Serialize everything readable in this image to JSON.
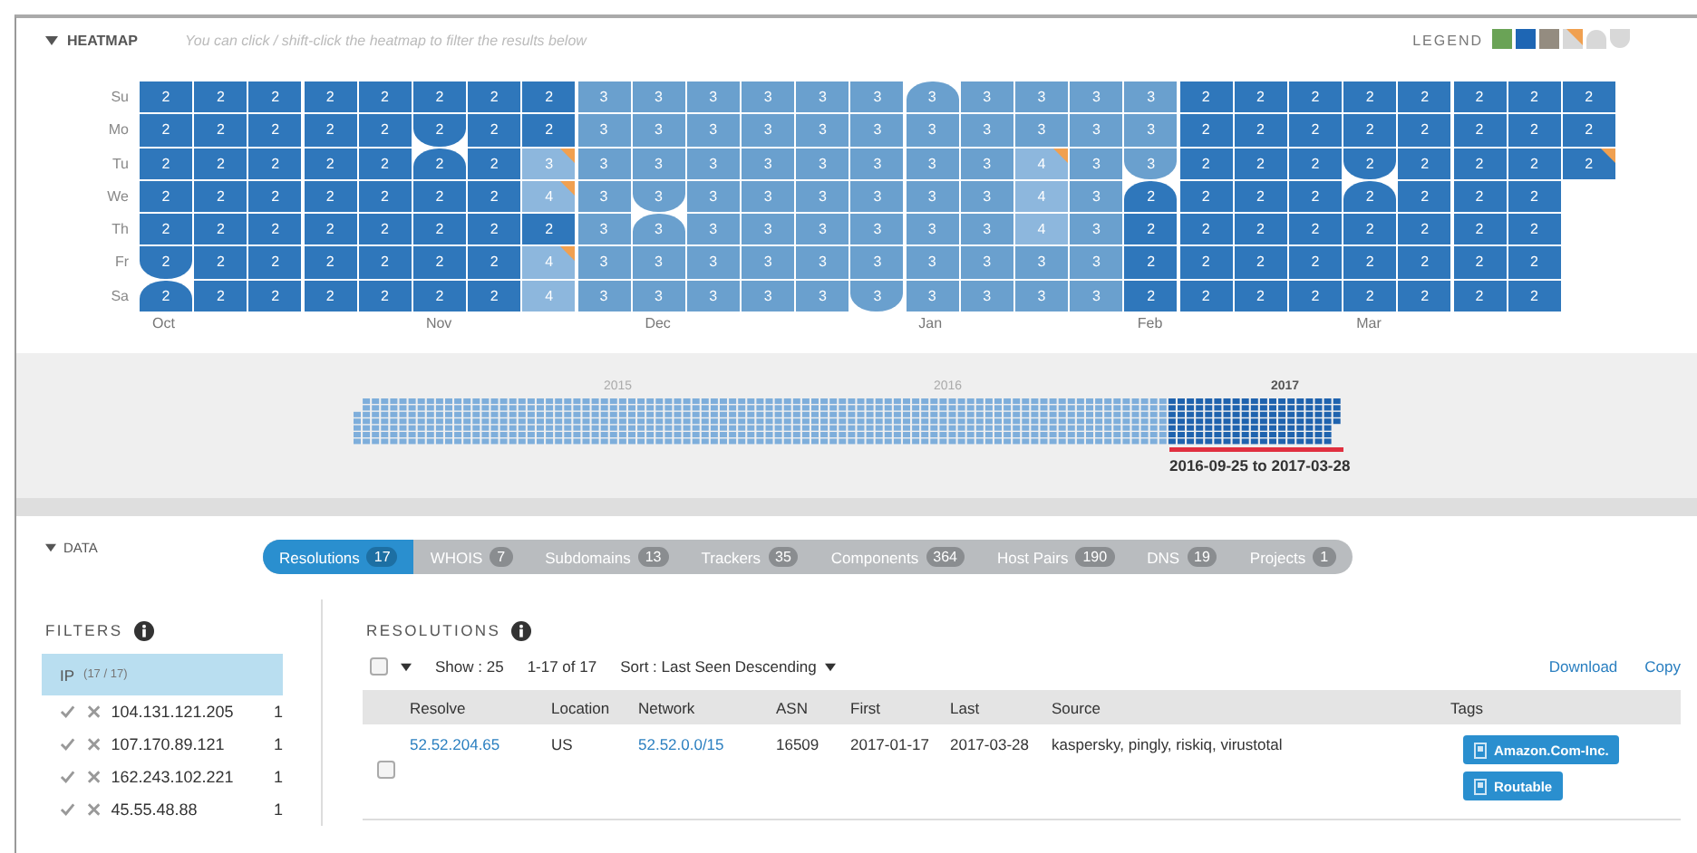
{
  "heatmap": {
    "title": "HEATMAP",
    "hint": "You can click / shift-click the heatmap to filter the results below",
    "legend_label": "LEGEND",
    "days": [
      "Su",
      "Mo",
      "Tu",
      "We",
      "Th",
      "Fr",
      "Sa"
    ],
    "weeks": [
      {
        "month_label": "Oct",
        "cells": [
          {
            "value": "2",
            "color": "#2f77bb",
            "flagged": false,
            "month_start": false
          },
          {
            "value": "2",
            "color": "#2f77bb",
            "flagged": false,
            "month_start": false
          },
          {
            "value": "2",
            "color": "#2f77bb",
            "flagged": false,
            "month_start": false
          },
          {
            "value": "2",
            "color": "#2f77bb",
            "flagged": false,
            "month_start": false
          },
          {
            "value": "2",
            "color": "#2f77bb",
            "flagged": false,
            "month_start": false
          },
          {
            "value": "2",
            "color": "#2f77bb",
            "flagged": false,
            "month_start": false
          },
          {
            "value": "2",
            "color": "#2f77bb",
            "flagged": false,
            "month_start": true
          }
        ]
      },
      {
        "cells": [
          {
            "value": "2",
            "color": "#2f77bb",
            "flagged": false,
            "month_start": false
          },
          {
            "value": "2",
            "color": "#2f77bb",
            "flagged": false,
            "month_start": false
          },
          {
            "value": "2",
            "color": "#2f77bb",
            "flagged": false,
            "month_start": false
          },
          {
            "value": "2",
            "color": "#2f77bb",
            "flagged": false,
            "month_start": false
          },
          {
            "value": "2",
            "color": "#2f77bb",
            "flagged": false,
            "month_start": false
          },
          {
            "value": "2",
            "color": "#2f77bb",
            "flagged": false,
            "month_start": false
          },
          {
            "value": "2",
            "color": "#2f77bb",
            "flagged": false,
            "month_start": false
          }
        ]
      },
      {
        "cells": [
          {
            "value": "2",
            "color": "#2f77bb",
            "flagged": false,
            "month_start": false
          },
          {
            "value": "2",
            "color": "#2f77bb",
            "flagged": false,
            "month_start": false
          },
          {
            "value": "2",
            "color": "#2f77bb",
            "flagged": false,
            "month_start": false
          },
          {
            "value": "2",
            "color": "#2f77bb",
            "flagged": false,
            "month_start": false
          },
          {
            "value": "2",
            "color": "#2f77bb",
            "flagged": false,
            "month_start": false
          },
          {
            "value": "2",
            "color": "#2f77bb",
            "flagged": false,
            "month_start": false
          },
          {
            "value": "2",
            "color": "#2f77bb",
            "flagged": false,
            "month_start": false
          }
        ]
      },
      {
        "cells": [
          {
            "value": "2",
            "color": "#2f77bb",
            "flagged": false,
            "month_start": false
          },
          {
            "value": "2",
            "color": "#2f77bb",
            "flagged": false,
            "month_start": false
          },
          {
            "value": "2",
            "color": "#2f77bb",
            "flagged": false,
            "month_start": false
          },
          {
            "value": "2",
            "color": "#2f77bb",
            "flagged": false,
            "month_start": false
          },
          {
            "value": "2",
            "color": "#2f77bb",
            "flagged": false,
            "month_start": false
          },
          {
            "value": "2",
            "color": "#2f77bb",
            "flagged": false,
            "month_start": false
          },
          {
            "value": "2",
            "color": "#2f77bb",
            "flagged": false,
            "month_start": false
          }
        ]
      },
      {
        "cells": [
          {
            "value": "2",
            "color": "#2f77bb",
            "flagged": false,
            "month_start": false
          },
          {
            "value": "2",
            "color": "#2f77bb",
            "flagged": false,
            "month_start": false
          },
          {
            "value": "2",
            "color": "#2f77bb",
            "flagged": false,
            "month_start": false
          },
          {
            "value": "2",
            "color": "#2f77bb",
            "flagged": false,
            "month_start": false
          },
          {
            "value": "2",
            "color": "#2f77bb",
            "flagged": false,
            "month_start": false
          },
          {
            "value": "2",
            "color": "#2f77bb",
            "flagged": false,
            "month_start": false
          },
          {
            "value": "2",
            "color": "#2f77bb",
            "flagged": false,
            "month_start": false
          }
        ]
      },
      {
        "month_label": "Nov",
        "cells": [
          {
            "value": "2",
            "color": "#2f77bb",
            "flagged": false,
            "month_start": false
          },
          {
            "value": "2",
            "color": "#2f77bb",
            "flagged": false,
            "month_start": false
          },
          {
            "value": "2",
            "color": "#2f77bb",
            "flagged": false,
            "month_start": true
          },
          {
            "value": "2",
            "color": "#2f77bb",
            "flagged": false,
            "month_start": false
          },
          {
            "value": "2",
            "color": "#2f77bb",
            "flagged": false,
            "month_start": false
          },
          {
            "value": "2",
            "color": "#2f77bb",
            "flagged": false,
            "month_start": false
          },
          {
            "value": "2",
            "color": "#2f77bb",
            "flagged": false,
            "month_start": false
          }
        ]
      },
      {
        "cells": [
          {
            "value": "2",
            "color": "#2f77bb",
            "flagged": false,
            "month_start": false
          },
          {
            "value": "2",
            "color": "#2f77bb",
            "flagged": false,
            "month_start": false
          },
          {
            "value": "2",
            "color": "#2f77bb",
            "flagged": false,
            "month_start": false
          },
          {
            "value": "2",
            "color": "#2f77bb",
            "flagged": false,
            "month_start": false
          },
          {
            "value": "2",
            "color": "#2f77bb",
            "flagged": false,
            "month_start": false
          },
          {
            "value": "2",
            "color": "#2f77bb",
            "flagged": false,
            "month_start": false
          },
          {
            "value": "2",
            "color": "#2f77bb",
            "flagged": false,
            "month_start": false
          }
        ]
      },
      {
        "cells": [
          {
            "value": "2",
            "color": "#2f77bb",
            "flagged": false,
            "month_start": false
          },
          {
            "value": "2",
            "color": "#2f77bb",
            "flagged": false,
            "month_start": false
          },
          {
            "value": "3",
            "color": "#8db7dd",
            "flagged": true,
            "month_start": false
          },
          {
            "value": "4",
            "color": "#8db7dd",
            "flagged": true,
            "month_start": false
          },
          {
            "value": "2",
            "color": "#2f77bb",
            "flagged": false,
            "month_start": false
          },
          {
            "value": "4",
            "color": "#8db7dd",
            "flagged": true,
            "month_start": false
          },
          {
            "value": "4",
            "color": "#8db7dd",
            "flagged": false,
            "month_start": false
          }
        ]
      },
      {
        "cells": [
          {
            "value": "3",
            "color": "#6aa0ce",
            "flagged": false,
            "month_start": false
          },
          {
            "value": "3",
            "color": "#6aa0ce",
            "flagged": false,
            "month_start": false
          },
          {
            "value": "3",
            "color": "#6aa0ce",
            "flagged": false,
            "month_start": false
          },
          {
            "value": "3",
            "color": "#6aa0ce",
            "flagged": false,
            "month_start": false
          },
          {
            "value": "3",
            "color": "#6aa0ce",
            "flagged": false,
            "month_start": false
          },
          {
            "value": "3",
            "color": "#6aa0ce",
            "flagged": false,
            "month_start": false
          },
          {
            "value": "3",
            "color": "#6aa0ce",
            "flagged": false,
            "month_start": false
          }
        ]
      },
      {
        "month_label": "Dec",
        "cells": [
          {
            "value": "3",
            "color": "#6aa0ce",
            "flagged": false,
            "month_start": false
          },
          {
            "value": "3",
            "color": "#6aa0ce",
            "flagged": false,
            "month_start": false
          },
          {
            "value": "3",
            "color": "#6aa0ce",
            "flagged": false,
            "month_start": false
          },
          {
            "value": "3",
            "color": "#6aa0ce",
            "flagged": false,
            "month_start": false
          },
          {
            "value": "3",
            "color": "#6aa0ce",
            "flagged": false,
            "month_start": true
          },
          {
            "value": "3",
            "color": "#6aa0ce",
            "flagged": false,
            "month_start": false
          },
          {
            "value": "3",
            "color": "#6aa0ce",
            "flagged": false,
            "month_start": false
          }
        ]
      },
      {
        "cells": [
          {
            "value": "3",
            "color": "#6aa0ce",
            "flagged": false,
            "month_start": false
          },
          {
            "value": "3",
            "color": "#6aa0ce",
            "flagged": false,
            "month_start": false
          },
          {
            "value": "3",
            "color": "#6aa0ce",
            "flagged": false,
            "month_start": false
          },
          {
            "value": "3",
            "color": "#6aa0ce",
            "flagged": false,
            "month_start": false
          },
          {
            "value": "3",
            "color": "#6aa0ce",
            "flagged": false,
            "month_start": false
          },
          {
            "value": "3",
            "color": "#6aa0ce",
            "flagged": false,
            "month_start": false
          },
          {
            "value": "3",
            "color": "#6aa0ce",
            "flagged": false,
            "month_start": false
          }
        ]
      },
      {
        "cells": [
          {
            "value": "3",
            "color": "#6aa0ce",
            "flagged": false,
            "month_start": false
          },
          {
            "value": "3",
            "color": "#6aa0ce",
            "flagged": false,
            "month_start": false
          },
          {
            "value": "3",
            "color": "#6aa0ce",
            "flagged": false,
            "month_start": false
          },
          {
            "value": "3",
            "color": "#6aa0ce",
            "flagged": false,
            "month_start": false
          },
          {
            "value": "3",
            "color": "#6aa0ce",
            "flagged": false,
            "month_start": false
          },
          {
            "value": "3",
            "color": "#6aa0ce",
            "flagged": false,
            "month_start": false
          },
          {
            "value": "3",
            "color": "#6aa0ce",
            "flagged": false,
            "month_start": false
          }
        ]
      },
      {
        "cells": [
          {
            "value": "3",
            "color": "#6aa0ce",
            "flagged": false,
            "month_start": false
          },
          {
            "value": "3",
            "color": "#6aa0ce",
            "flagged": false,
            "month_start": false
          },
          {
            "value": "3",
            "color": "#6aa0ce",
            "flagged": false,
            "month_start": false
          },
          {
            "value": "3",
            "color": "#6aa0ce",
            "flagged": false,
            "month_start": false
          },
          {
            "value": "3",
            "color": "#6aa0ce",
            "flagged": false,
            "month_start": false
          },
          {
            "value": "3",
            "color": "#6aa0ce",
            "flagged": false,
            "month_start": false
          },
          {
            "value": "3",
            "color": "#6aa0ce",
            "flagged": false,
            "month_start": false
          }
        ]
      },
      {
        "cells": [
          {
            "value": "3",
            "color": "#6aa0ce",
            "flagged": false,
            "month_start": false
          },
          {
            "value": "3",
            "color": "#6aa0ce",
            "flagged": false,
            "month_start": false
          },
          {
            "value": "3",
            "color": "#6aa0ce",
            "flagged": false,
            "month_start": false
          },
          {
            "value": "3",
            "color": "#6aa0ce",
            "flagged": false,
            "month_start": false
          },
          {
            "value": "3",
            "color": "#6aa0ce",
            "flagged": false,
            "month_start": false
          },
          {
            "value": "3",
            "color": "#6aa0ce",
            "flagged": false,
            "month_start": false
          },
          {
            "value": "3",
            "color": "#6aa0ce",
            "flagged": false,
            "month_start": false
          }
        ]
      },
      {
        "month_label": "Jan",
        "cells": [
          {
            "value": "3",
            "color": "#6aa0ce",
            "flagged": false,
            "month_start": true
          },
          {
            "value": "3",
            "color": "#6aa0ce",
            "flagged": false,
            "month_start": false
          },
          {
            "value": "3",
            "color": "#6aa0ce",
            "flagged": false,
            "month_start": false
          },
          {
            "value": "3",
            "color": "#6aa0ce",
            "flagged": false,
            "month_start": false
          },
          {
            "value": "3",
            "color": "#6aa0ce",
            "flagged": false,
            "month_start": false
          },
          {
            "value": "3",
            "color": "#6aa0ce",
            "flagged": false,
            "month_start": false
          },
          {
            "value": "3",
            "color": "#6aa0ce",
            "flagged": false,
            "month_start": false
          }
        ]
      },
      {
        "cells": [
          {
            "value": "3",
            "color": "#6aa0ce",
            "flagged": false,
            "month_start": false
          },
          {
            "value": "3",
            "color": "#6aa0ce",
            "flagged": false,
            "month_start": false
          },
          {
            "value": "3",
            "color": "#6aa0ce",
            "flagged": false,
            "month_start": false
          },
          {
            "value": "3",
            "color": "#6aa0ce",
            "flagged": false,
            "month_start": false
          },
          {
            "value": "3",
            "color": "#6aa0ce",
            "flagged": false,
            "month_start": false
          },
          {
            "value": "3",
            "color": "#6aa0ce",
            "flagged": false,
            "month_start": false
          },
          {
            "value": "3",
            "color": "#6aa0ce",
            "flagged": false,
            "month_start": false
          }
        ]
      },
      {
        "cells": [
          {
            "value": "3",
            "color": "#6aa0ce",
            "flagged": false,
            "month_start": false
          },
          {
            "value": "3",
            "color": "#6aa0ce",
            "flagged": false,
            "month_start": false
          },
          {
            "value": "4",
            "color": "#8db7dd",
            "flagged": true,
            "month_start": false
          },
          {
            "value": "4",
            "color": "#8db7dd",
            "flagged": false,
            "month_start": false
          },
          {
            "value": "4",
            "color": "#8db7dd",
            "flagged": false,
            "month_start": false
          },
          {
            "value": "3",
            "color": "#6aa0ce",
            "flagged": false,
            "month_start": false
          },
          {
            "value": "3",
            "color": "#6aa0ce",
            "flagged": false,
            "month_start": false
          }
        ]
      },
      {
        "cells": [
          {
            "value": "3",
            "color": "#6aa0ce",
            "flagged": false,
            "month_start": false
          },
          {
            "value": "3",
            "color": "#6aa0ce",
            "flagged": false,
            "month_start": false
          },
          {
            "value": "3",
            "color": "#6aa0ce",
            "flagged": false,
            "month_start": false
          },
          {
            "value": "3",
            "color": "#6aa0ce",
            "flagged": false,
            "month_start": false
          },
          {
            "value": "3",
            "color": "#6aa0ce",
            "flagged": false,
            "month_start": false
          },
          {
            "value": "3",
            "color": "#6aa0ce",
            "flagged": false,
            "month_start": false
          },
          {
            "value": "3",
            "color": "#6aa0ce",
            "flagged": false,
            "month_start": false
          }
        ]
      },
      {
        "month_label": "Feb",
        "cells": [
          {
            "value": "3",
            "color": "#6aa0ce",
            "flagged": false,
            "month_start": false
          },
          {
            "value": "3",
            "color": "#6aa0ce",
            "flagged": false,
            "month_start": false
          },
          {
            "value": "3",
            "color": "#6aa0ce",
            "flagged": false,
            "month_start": false
          },
          {
            "value": "2",
            "color": "#2f77bb",
            "flagged": false,
            "month_start": true
          },
          {
            "value": "2",
            "color": "#2f77bb",
            "flagged": false,
            "month_start": false
          },
          {
            "value": "2",
            "color": "#2f77bb",
            "flagged": false,
            "month_start": false
          },
          {
            "value": "2",
            "color": "#2f77bb",
            "flagged": false,
            "month_start": false
          }
        ]
      },
      {
        "cells": [
          {
            "value": "2",
            "color": "#2f77bb",
            "flagged": false,
            "month_start": false
          },
          {
            "value": "2",
            "color": "#2f77bb",
            "flagged": false,
            "month_start": false
          },
          {
            "value": "2",
            "color": "#2f77bb",
            "flagged": false,
            "month_start": false
          },
          {
            "value": "2",
            "color": "#2f77bb",
            "flagged": false,
            "month_start": false
          },
          {
            "value": "2",
            "color": "#2f77bb",
            "flagged": false,
            "month_start": false
          },
          {
            "value": "2",
            "color": "#2f77bb",
            "flagged": false,
            "month_start": false
          },
          {
            "value": "2",
            "color": "#2f77bb",
            "flagged": false,
            "month_start": false
          }
        ]
      },
      {
        "cells": [
          {
            "value": "2",
            "color": "#2f77bb",
            "flagged": false,
            "month_start": false
          },
          {
            "value": "2",
            "color": "#2f77bb",
            "flagged": false,
            "month_start": false
          },
          {
            "value": "2",
            "color": "#2f77bb",
            "flagged": false,
            "month_start": false
          },
          {
            "value": "2",
            "color": "#2f77bb",
            "flagged": false,
            "month_start": false
          },
          {
            "value": "2",
            "color": "#2f77bb",
            "flagged": false,
            "month_start": false
          },
          {
            "value": "2",
            "color": "#2f77bb",
            "flagged": false,
            "month_start": false
          },
          {
            "value": "2",
            "color": "#2f77bb",
            "flagged": false,
            "month_start": false
          }
        ]
      },
      {
        "cells": [
          {
            "value": "2",
            "color": "#2f77bb",
            "flagged": false,
            "month_start": false
          },
          {
            "value": "2",
            "color": "#2f77bb",
            "flagged": false,
            "month_start": false
          },
          {
            "value": "2",
            "color": "#2f77bb",
            "flagged": false,
            "month_start": false
          },
          {
            "value": "2",
            "color": "#2f77bb",
            "flagged": false,
            "month_start": false
          },
          {
            "value": "2",
            "color": "#2f77bb",
            "flagged": false,
            "month_start": false
          },
          {
            "value": "2",
            "color": "#2f77bb",
            "flagged": false,
            "month_start": false
          },
          {
            "value": "2",
            "color": "#2f77bb",
            "flagged": false,
            "month_start": false
          }
        ]
      },
      {
        "month_label": "Mar",
        "cells": [
          {
            "value": "2",
            "color": "#2f77bb",
            "flagged": false,
            "month_start": false
          },
          {
            "value": "2",
            "color": "#2f77bb",
            "flagged": false,
            "month_start": false
          },
          {
            "value": "2",
            "color": "#2f77bb",
            "flagged": false,
            "month_start": false
          },
          {
            "value": "2",
            "color": "#2f77bb",
            "flagged": false,
            "month_start": true
          },
          {
            "value": "2",
            "color": "#2f77bb",
            "flagged": false,
            "month_start": false
          },
          {
            "value": "2",
            "color": "#2f77bb",
            "flagged": false,
            "month_start": false
          },
          {
            "value": "2",
            "color": "#2f77bb",
            "flagged": false,
            "month_start": false
          }
        ]
      },
      {
        "cells": [
          {
            "value": "2",
            "color": "#2f77bb",
            "flagged": false,
            "month_start": false
          },
          {
            "value": "2",
            "color": "#2f77bb",
            "flagged": false,
            "month_start": false
          },
          {
            "value": "2",
            "color": "#2f77bb",
            "flagged": false,
            "month_start": false
          },
          {
            "value": "2",
            "color": "#2f77bb",
            "flagged": false,
            "month_start": false
          },
          {
            "value": "2",
            "color": "#2f77bb",
            "flagged": false,
            "month_start": false
          },
          {
            "value": "2",
            "color": "#2f77bb",
            "flagged": false,
            "month_start": false
          },
          {
            "value": "2",
            "color": "#2f77bb",
            "flagged": false,
            "month_start": false
          }
        ]
      },
      {
        "cells": [
          {
            "value": "2",
            "color": "#2f77bb",
            "flagged": false,
            "month_start": false
          },
          {
            "value": "2",
            "color": "#2f77bb",
            "flagged": false,
            "month_start": false
          },
          {
            "value": "2",
            "color": "#2f77bb",
            "flagged": false,
            "month_start": false
          },
          {
            "value": "2",
            "color": "#2f77bb",
            "flagged": false,
            "month_start": false
          },
          {
            "value": "2",
            "color": "#2f77bb",
            "flagged": false,
            "month_start": false
          },
          {
            "value": "2",
            "color": "#2f77bb",
            "flagged": false,
            "month_start": false
          },
          {
            "value": "2",
            "color": "#2f77bb",
            "flagged": false,
            "month_start": false
          }
        ]
      },
      {
        "cells": [
          {
            "value": "2",
            "color": "#2f77bb",
            "flagged": false,
            "month_start": false
          },
          {
            "value": "2",
            "color": "#2f77bb",
            "flagged": false,
            "month_start": false
          },
          {
            "value": "2",
            "color": "#2f77bb",
            "flagged": false,
            "month_start": false
          },
          {
            "value": "2",
            "color": "#2f77bb",
            "flagged": false,
            "month_start": false
          },
          {
            "value": "2",
            "color": "#2f77bb",
            "flagged": false,
            "month_start": false
          },
          {
            "value": "2",
            "color": "#2f77bb",
            "flagged": false,
            "month_start": false
          },
          {
            "value": "2",
            "color": "#2f77bb",
            "flagged": false,
            "month_start": false
          }
        ]
      },
      {
        "cells": [
          {
            "value": "2",
            "color": "#2f77bb",
            "flagged": false,
            "month_start": false
          },
          {
            "value": "2",
            "color": "#2f77bb",
            "flagged": false,
            "month_start": false
          },
          {
            "value": "2",
            "color": "#2f77bb",
            "flagged": true,
            "month_start": false
          }
        ]
      }
    ]
  },
  "timeline": {
    "years": [
      "2015",
      "2016",
      "2017"
    ],
    "range_label": "2016-09-25 to 2017-03-28"
  },
  "data": {
    "title": "DATA",
    "tabs": [
      {
        "label": "Resolutions",
        "count": "17",
        "selected": true
      },
      {
        "label": "WHOIS",
        "count": "7",
        "selected": false
      },
      {
        "label": "Subdomains",
        "count": "13",
        "selected": false
      },
      {
        "label": "Trackers",
        "count": "35",
        "selected": false
      },
      {
        "label": "Components",
        "count": "364",
        "selected": false
      },
      {
        "label": "Host Pairs",
        "count": "190",
        "selected": false
      },
      {
        "label": "DNS",
        "count": "19",
        "selected": false
      },
      {
        "label": "Projects",
        "count": "1",
        "selected": false
      }
    ]
  },
  "filters": {
    "title": "FILTERS",
    "group": {
      "label": "IP",
      "count": "(17 / 17)",
      "selected": true
    },
    "items": [
      {
        "value": "104.131.121.205",
        "count": "1"
      },
      {
        "value": "107.170.89.121",
        "count": "1"
      },
      {
        "value": "162.243.102.221",
        "count": "1"
      },
      {
        "value": "45.55.48.88",
        "count": "1"
      }
    ]
  },
  "resolutions": {
    "title": "RESOLUTIONS",
    "select_all_checked": false,
    "show": "Show : 25",
    "range": "1-17 of 17",
    "sort": "Sort : Last Seen Descending",
    "actions": [
      "Download",
      "Copy"
    ],
    "columns": [
      "Resolve",
      "Location",
      "Network",
      "ASN",
      "First",
      "Last",
      "Source",
      "Tags"
    ],
    "rows": [
      {
        "checked": false,
        "resolve": "52.52.204.65",
        "location": "US",
        "network": "52.52.0.0/15",
        "asn": "16509",
        "first": "2017-01-17",
        "last": "2017-03-28",
        "source": "kaspersky, pingly, riskiq, virustotal",
        "tags": [
          "Amazon.Com-Inc.",
          "Routable"
        ]
      }
    ]
  }
}
